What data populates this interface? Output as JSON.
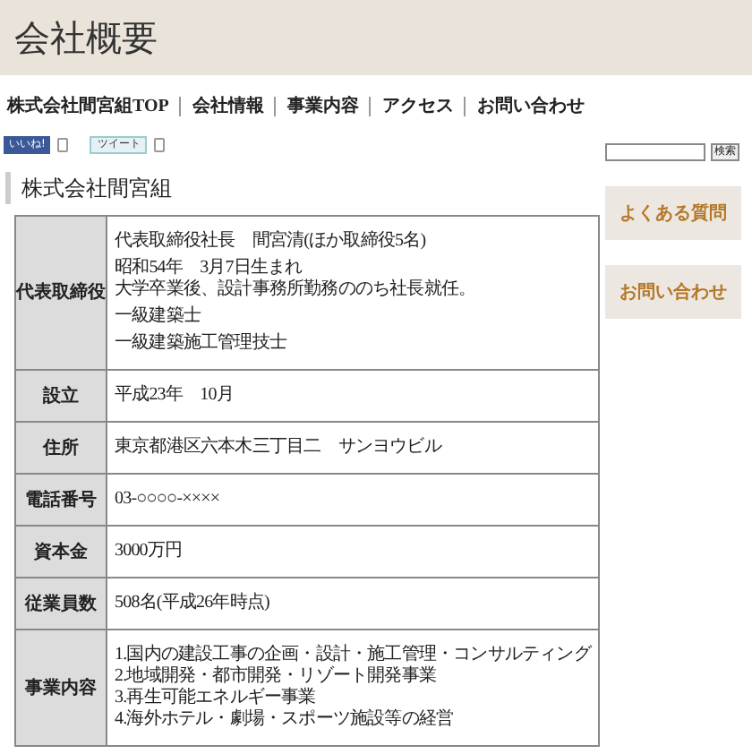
{
  "header": {
    "title": "会社概要"
  },
  "nav": [
    "株式会社間宮組TOP",
    "会社情報",
    "事業内容",
    "アクセス",
    "お問い合わせ"
  ],
  "social": {
    "like": "いいね!",
    "tweet": "ツイート"
  },
  "section_title": "株式会社間宮組",
  "table": {
    "rows": [
      {
        "label": "代表取締役",
        "paragraphs": [
          [
            "代表取締役社長　間宮清(ほか取締役5名)"
          ],
          [
            "昭和54年　3月7日生まれ",
            "大学卒業後、設計事務所勤務ののち社長就任。"
          ],
          [
            "一級建築士"
          ],
          [
            "一級建築施工管理技士"
          ]
        ]
      },
      {
        "label": "設立",
        "paragraphs": [
          [
            "平成23年　10月"
          ]
        ]
      },
      {
        "label": "住所",
        "paragraphs": [
          [
            "東京都港区六本木三丁目二　サンヨウビル"
          ]
        ]
      },
      {
        "label": "電話番号",
        "paragraphs": [
          [
            "03-○○○○-××××"
          ]
        ]
      },
      {
        "label": "資本金",
        "paragraphs": [
          [
            "3000万円"
          ]
        ]
      },
      {
        "label": "従業員数",
        "paragraphs": [
          [
            "508名(平成26年時点)"
          ]
        ]
      },
      {
        "label": "事業内容",
        "paragraphs": [
          [
            "1.国内の建設工事の企画・設計・施工管理・コンサルティング",
            "2.地域開発・都市開発・リゾート開発事業",
            "3.再生可能エネルギー事業",
            "4.海外ホテル・劇場・スポーツ施設等の経営"
          ]
        ]
      }
    ]
  },
  "sidebar": {
    "search_button": "検索",
    "links": [
      "よくある質問",
      "お問い合わせ"
    ]
  }
}
